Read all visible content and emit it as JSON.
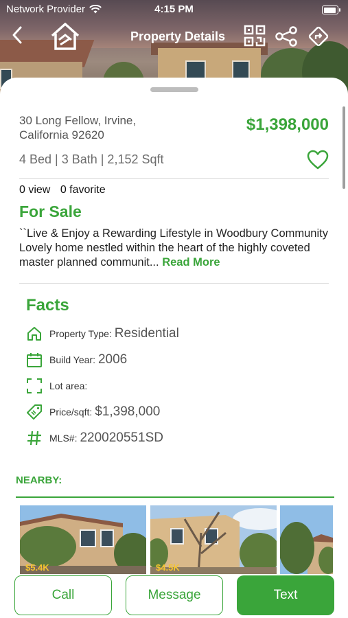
{
  "status_bar": {
    "carrier": "Network Provider",
    "time": "4:15 PM"
  },
  "nav": {
    "title": "Property Details"
  },
  "property": {
    "address_line1": "30 Long Fellow, Irvine,",
    "address_line2": "California 92620",
    "price": "$1,398,000",
    "specs": "4 Bed | 3 Bath | 2,152 Sqft",
    "views": "0 view",
    "favorites": "0 favorite",
    "status": "For Sale",
    "description": "``Live & Enjoy a Rewarding Lifestyle in Woodbury Community Lovely home nestled within the heart of the highly coveted master planned communit...",
    "read_more": "Read More"
  },
  "facts": {
    "title": "Facts",
    "items": [
      {
        "label": "Property Type",
        "value": "Residential",
        "icon": "home-icon"
      },
      {
        "label": "Build Year",
        "value": "2006",
        "icon": "calendar-icon"
      },
      {
        "label": "Lot area",
        "value": "",
        "icon": "frame-icon"
      },
      {
        "label": "Price/sqft",
        "value": "$1,398,000",
        "icon": "price-tag-icon"
      },
      {
        "label": "MLS#",
        "value": "220020551SD",
        "icon": "hash-icon"
      }
    ]
  },
  "nearby": {
    "title": "NEARBY:",
    "items": [
      {
        "price": "$5.4K"
      },
      {
        "price": "$4.5K"
      },
      {
        "price": ""
      }
    ]
  },
  "actions": {
    "call": "Call",
    "message": "Message",
    "text": "Text"
  },
  "colors": {
    "accent": "#3aa53a"
  }
}
